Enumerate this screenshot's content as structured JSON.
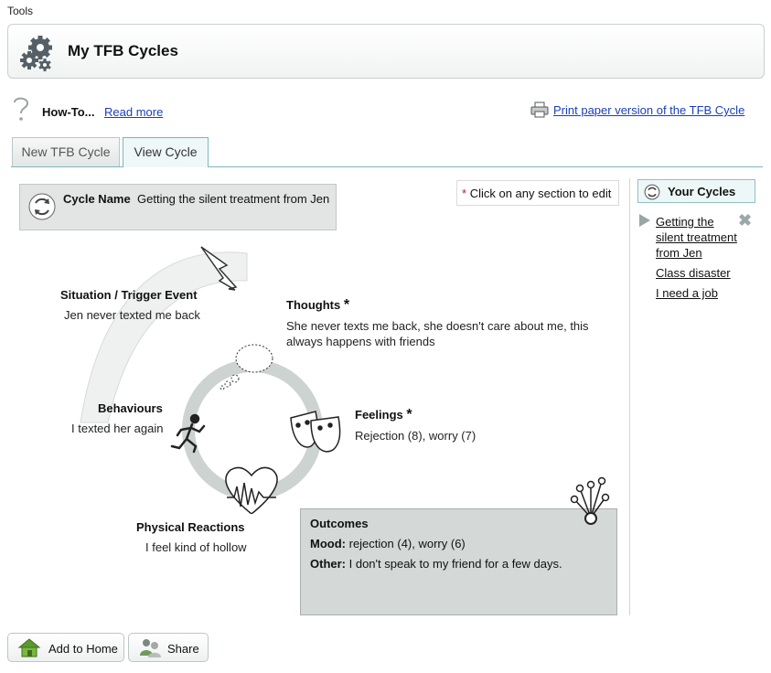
{
  "breadcrumb": "Tools",
  "header": {
    "title": "My TFB Cycles",
    "icon": "gears-icon"
  },
  "howto": {
    "label": "How-To...",
    "link": "Read more"
  },
  "print": {
    "link": "Print paper version of the TFB Cycle"
  },
  "tabs": [
    {
      "label": "New TFB Cycle",
      "active": false
    },
    {
      "label": "View Cycle",
      "active": true
    }
  ],
  "cycle_name": {
    "label": "Cycle Name",
    "value": "Getting the silent treatment from Jen"
  },
  "click_note": {
    "star": "*",
    "text": "Click on any section to edit"
  },
  "sections": {
    "situation": {
      "title": "Situation / Trigger Event",
      "text": "Jen never texted me back"
    },
    "thoughts": {
      "title": "Thoughts",
      "star": "*",
      "text_line1": "She never texts me back, she doesn't care about me, this",
      "text_line2": "always happens with friends"
    },
    "behaviours": {
      "title": "Behaviours",
      "text": "I texted her again"
    },
    "feelings": {
      "title": "Feelings",
      "star": "*",
      "text": "Rejection (8), worry (7)"
    },
    "physical": {
      "title": "Physical Reactions",
      "text": "I feel kind of hollow"
    }
  },
  "outcomes": {
    "title": "Outcomes",
    "mood_label": "Mood:",
    "mood_value": "rejection (4), worry (6)",
    "other_label": "Other:",
    "other_value": "I don't speak to my friend for a few days."
  },
  "sidebar": {
    "title": "Your Cycles",
    "items": [
      {
        "line1": "Getting the",
        "line2": "silent treatment",
        "line3": "from Jen",
        "active": true
      },
      {
        "line1": "Class disaster"
      },
      {
        "line1": "I need a job"
      }
    ],
    "close": "✖"
  },
  "buttons": {
    "add_home": "Add to Home",
    "share": "Share"
  },
  "colors": {
    "link": "#1a3fb8",
    "accent": "#7fb6bd",
    "ring": "#cfd4d2",
    "box": "#d4d9d7"
  }
}
